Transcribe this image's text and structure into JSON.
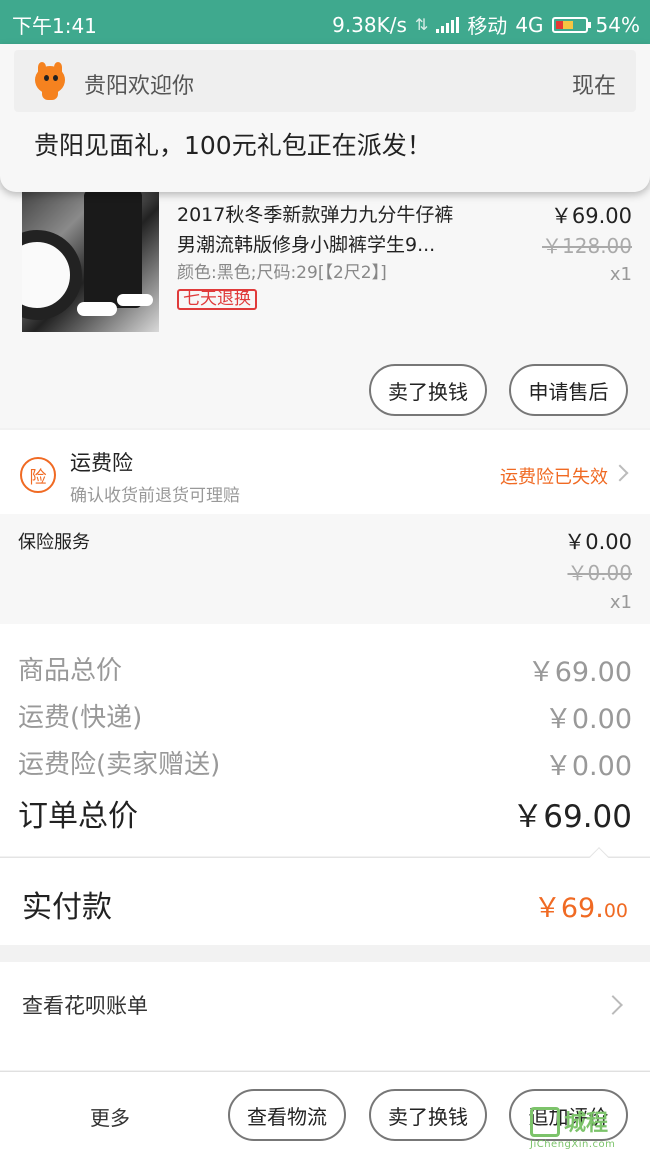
{
  "status_bar": {
    "time": "下午1:41",
    "speed": "9.38K/s",
    "carrier": "移动",
    "network": "4G",
    "battery": "54%"
  },
  "notification": {
    "app_name": "贵阳欢迎你",
    "time": "现在",
    "message": "贵阳见面礼，100元礼包正在派发！",
    "icon": "mascot-icon"
  },
  "product": {
    "title_line1": "2017秋冬季新款弹力九分牛仔裤",
    "title_line2": "男潮流韩版修身小脚裤学生9...",
    "attributes": "颜色:黑色;尺码:29[【2尺2】]",
    "tag": "七天退换",
    "price": "￥69.00",
    "original_price": "￥128.00",
    "quantity": "x1",
    "sell_button": "卖了换钱",
    "aftersale_button": "申请售后"
  },
  "shipping_insurance": {
    "icon_text": "险",
    "title": "运费险",
    "subtitle": "确认收货前退货可理赔",
    "status": "运费险已失效"
  },
  "insurance_service": {
    "label": "保险服务",
    "price": "￥0.00",
    "original_price": "￥0.00",
    "quantity": "x1"
  },
  "summary": {
    "rows": [
      {
        "label": "商品总价",
        "value": "￥69.00"
      },
      {
        "label": "运费(快递)",
        "value": "￥0.00"
      },
      {
        "label": "运费险(卖家赠送)",
        "value": "￥0.00"
      }
    ],
    "total_label": "订单总价",
    "total_value": "￥69.00"
  },
  "payment": {
    "label": "实付款",
    "amount_main": "￥69.",
    "amount_cents": "00"
  },
  "huabei": {
    "label": "查看花呗账单"
  },
  "bottom_bar": {
    "more": "更多",
    "logistics": "查看物流",
    "sell": "卖了换钱",
    "review": "追加评价"
  },
  "watermark": {
    "text": "城程",
    "url": "JiChengXin.com"
  },
  "colors": {
    "status_bar": "#3fa98e",
    "accent_orange": "#f06a23",
    "tag_red": "#e03b3b"
  }
}
